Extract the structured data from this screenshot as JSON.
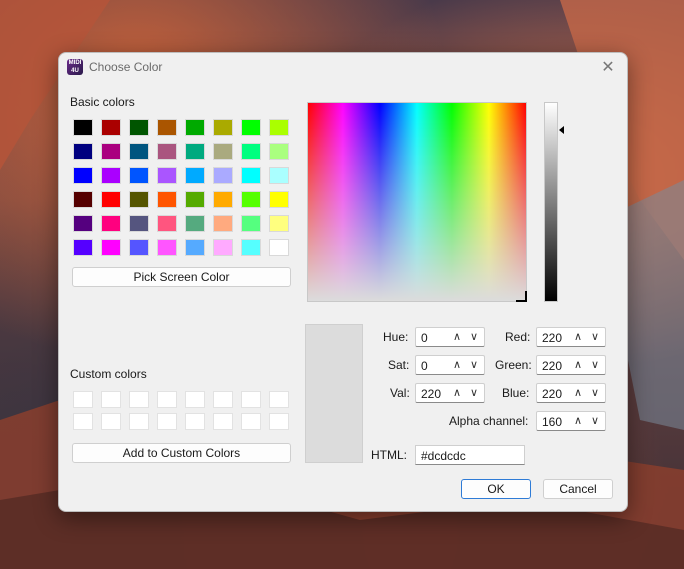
{
  "window": {
    "title": "Choose Color",
    "app_icon_text": "MIDI 4U"
  },
  "basic": {
    "label": "Basic colors",
    "rows": [
      [
        "#000000",
        "#aa0000",
        "#005500",
        "#aa5500",
        "#00aa00",
        "#aaaa00",
        "#00ff00",
        "#aaff00"
      ],
      [
        "#00007f",
        "#aa007f",
        "#00557f",
        "#aa557f",
        "#00aa7f",
        "#aaaa7f",
        "#00ff7f",
        "#aaff7f"
      ],
      [
        "#0000ff",
        "#aa00ff",
        "#0055ff",
        "#aa55ff",
        "#00aaff",
        "#aaaaff",
        "#00ffff",
        "#aaffff"
      ],
      [
        "#550000",
        "#ff0000",
        "#555500",
        "#ff5500",
        "#55aa00",
        "#ffaa00",
        "#55ff00",
        "#ffff00"
      ],
      [
        "#55007f",
        "#ff007f",
        "#55557f",
        "#ff557f",
        "#55aa7f",
        "#ffaa7f",
        "#55ff7f",
        "#ffff7f"
      ],
      [
        "#5500ff",
        "#ff00ff",
        "#5555ff",
        "#ff55ff",
        "#55aaff",
        "#ffaaff",
        "#55ffff",
        "#ffffff"
      ]
    ]
  },
  "buttons": {
    "pick_screen": "Pick Screen Color",
    "add_custom": "Add to Custom Colors",
    "ok": "OK",
    "cancel": "Cancel"
  },
  "custom": {
    "label": "Custom colors",
    "count": 16
  },
  "fields": {
    "hue": {
      "label": "Hue:",
      "value": "0"
    },
    "sat": {
      "label": "Sat:",
      "value": "0"
    },
    "val": {
      "label": "Val:",
      "value": "220"
    },
    "red": {
      "label": "Red:",
      "value": "220"
    },
    "green": {
      "label": "Green:",
      "value": "220"
    },
    "blue": {
      "label": "Blue:",
      "value": "220"
    },
    "alpha": {
      "label": "Alpha channel:",
      "value": "160"
    },
    "html": {
      "label": "HTML:",
      "value": "#dcdcdc"
    }
  },
  "spin_glyphs": {
    "up": "∧",
    "down": "∨"
  },
  "current_color": "#dcdcdc",
  "close_glyph": "✕"
}
